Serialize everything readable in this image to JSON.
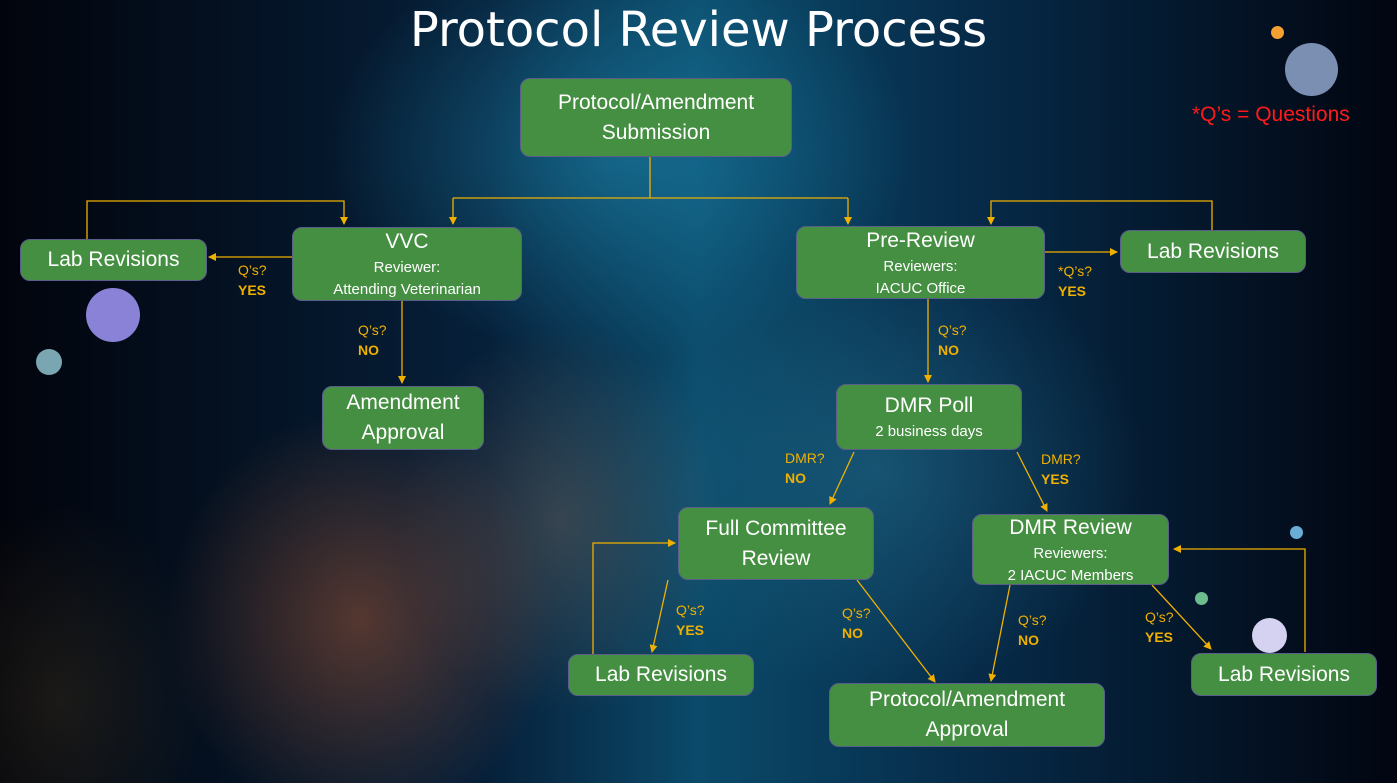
{
  "title": "Protocol Review Process",
  "legend": "*Q’s = Questions",
  "colors": {
    "node_fill": "#458f42",
    "arrow": "#f0b000",
    "legend": "#ff1a1a"
  },
  "nodes": {
    "submission": {
      "main": "Protocol/Amendment",
      "main2": "Submission"
    },
    "vvc": {
      "main": "VVC",
      "sub1": "Reviewer:",
      "sub2": "Attending Veterinarian"
    },
    "pre_review": {
      "main": "Pre-Review",
      "sub1": "Reviewers:",
      "sub2": "IACUC Office"
    },
    "lab_revisions_left": {
      "main": "Lab Revisions"
    },
    "lab_revisions_right": {
      "main": "Lab Revisions"
    },
    "amendment_approval": {
      "main": "Amendment",
      "main2": "Approval"
    },
    "dmr_poll": {
      "main": "DMR Poll",
      "sub1": "2 business days"
    },
    "full_committee": {
      "main": "Full Committee",
      "main2": "Review"
    },
    "dmr_review": {
      "main": "DMR Review",
      "sub1": "Reviewers:",
      "sub2": "2 IACUC Members"
    },
    "lab_revisions_fc": {
      "main": "Lab Revisions"
    },
    "lab_revisions_dmr": {
      "main": "Lab Revisions"
    },
    "final_approval": {
      "main": "Protocol/Amendment",
      "main2": "Approval"
    }
  },
  "labels": {
    "vvc_yes": {
      "q": "Q’s?",
      "a": "YES"
    },
    "vvc_no": {
      "q": "Q’s?",
      "a": "NO"
    },
    "pre_yes": {
      "q": "*Q’s?",
      "a": "YES"
    },
    "pre_no": {
      "q": "Q’s?",
      "a": "NO"
    },
    "dmr_no": {
      "q": "DMR?",
      "a": "NO"
    },
    "dmr_yes": {
      "q": "DMR?",
      "a": "YES"
    },
    "fc_yes": {
      "q": "Q’s?",
      "a": "YES"
    },
    "fc_no": {
      "q": "Q’s?",
      "a": "NO"
    },
    "dmrr_no": {
      "q": "Q’s?",
      "a": "NO"
    },
    "dmrr_yes": {
      "q": "Q’s?",
      "a": "YES"
    }
  }
}
